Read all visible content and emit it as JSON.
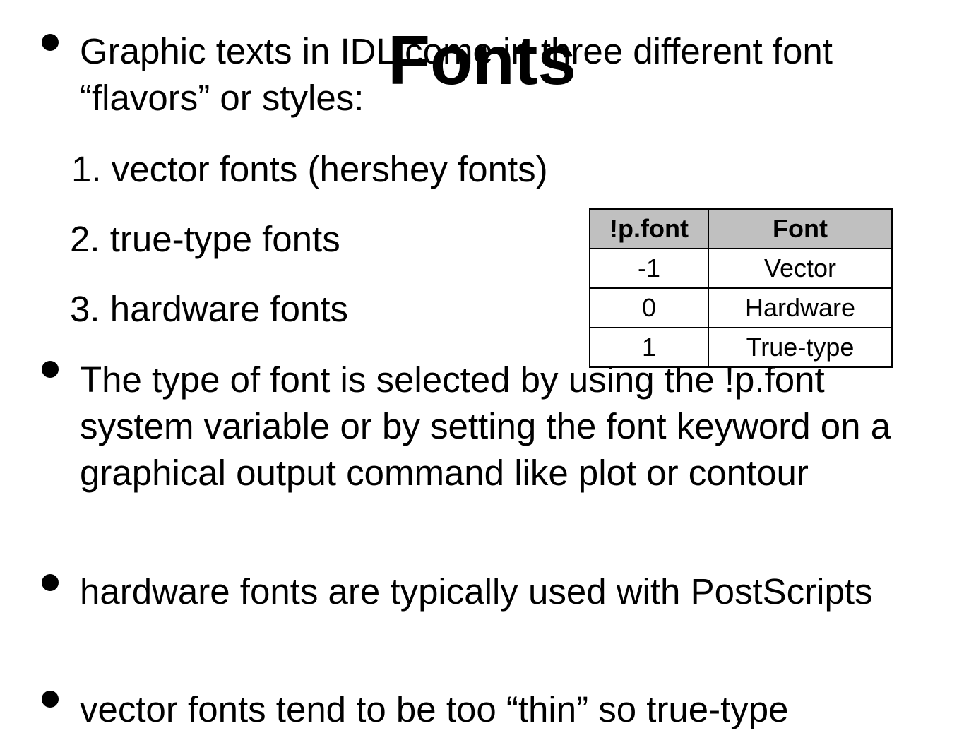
{
  "slide": {
    "title": "Fonts"
  },
  "bullets": [
    "Graphic texts in IDL come in three different font “flavors” or styles:",
    "The type of font is selected by using the !p.font system variable or by setting the font keyword on a graphical output command like plot or contour",
    "hardware fonts are typically used with PostScripts",
    "vector fonts tend to be too “thin” so true-type"
  ],
  "styles_list": [
    "1. vector fonts (hershey fonts)",
    "2. true-type fonts",
    "3. hardware fonts"
  ],
  "font_table": {
    "headers": [
      "!p.font",
      "Font"
    ],
    "rows": [
      [
        "-1",
        "Vector"
      ],
      [
        "0",
        "Hardware"
      ],
      [
        "1",
        "True-type"
      ]
    ]
  }
}
